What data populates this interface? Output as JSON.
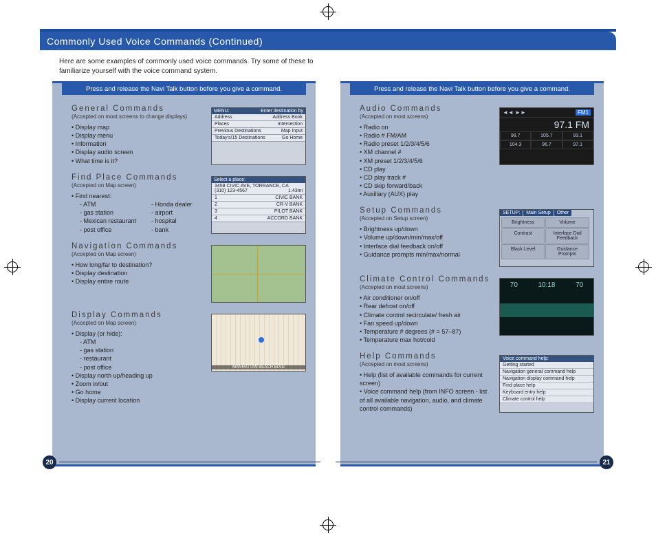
{
  "title": "Commonly Used Voice Commands (Continued)",
  "intro": "Here are some examples of commonly used voice commands. Try some of these to familiarize yourself with the voice command system.",
  "instruction": "Press and release the Navi Talk button before you give a command.",
  "page_left_num": "20",
  "page_right_num": "21",
  "left": {
    "sections": [
      {
        "title": "General Commands",
        "sub": "(Accepted on most screens to change displays)",
        "bullets": [
          "Display map",
          "Display menu",
          "Information",
          "Display audio screen",
          "What time is it?"
        ],
        "thumb": {
          "kind": "menu",
          "hdr_l": "MENU:",
          "hdr_r": "Enter destination by",
          "rows": [
            [
              "Address",
              "Address Book"
            ],
            [
              "Places",
              "Intersection"
            ],
            [
              "Previous Destinations",
              "Map Input"
            ],
            [
              "Today's/15 Destinations",
              "Go Home"
            ]
          ]
        }
      },
      {
        "title": "Find Place Commands",
        "sub": "(Accepted on Map screen)",
        "lead": "Find nearest:",
        "subcols": [
          [
            "ATM",
            "gas station",
            "Mexican restaurant",
            "post office"
          ],
          [
            "Honda dealer",
            "airport",
            "hospital",
            "bank"
          ]
        ],
        "thumb": {
          "kind": "list",
          "hdr": "Select a place:",
          "line1": "3458 CIVIC AVE, TORRANCE, CA",
          "line2": "(310) 123-4567",
          "dist": "1.43mi",
          "rows": [
            "CIVIC BANK",
            "CR-V BANK",
            "PILOT BANK",
            "ACCORD BANK"
          ]
        }
      },
      {
        "title": "Navigation Commands",
        "sub": "(Accepted on Map screen)",
        "bullets": [
          "How long/far to destination?",
          "Display destination",
          "Display entire route"
        ],
        "thumb": {
          "kind": "map"
        }
      },
      {
        "title": "Display Commands",
        "sub": "(Accepted on Map screen)",
        "lead": "Display (or hide):",
        "subcols": [
          [
            "ATM",
            "gas station",
            "restaurant",
            "post office"
          ]
        ],
        "bullets_after": [
          "Display north up/heading up",
          "Zoom in/out",
          "Go home",
          "Display current location"
        ],
        "thumb": {
          "kind": "city",
          "label": "MANHATTAN BEACH BLVD"
        }
      }
    ]
  },
  "right": {
    "sections": [
      {
        "title": "Audio Commands",
        "sub": "(Accepted on most screens)",
        "bullets": [
          "Radio on",
          "Radio # FM/AM",
          "Radio preset 1/2/3/4/5/6",
          "XM channel #",
          "XM preset 1/2/3/4/5/6",
          "CD play",
          "CD play track #",
          "CD skip forward/back",
          "Auxiliary (AUX) play"
        ],
        "thumb": {
          "kind": "radio",
          "band": "FM1",
          "freq": "97.1 FM",
          "presets": [
            "98.7",
            "105.7",
            "93.1",
            "104.3",
            "96.7",
            "97.1"
          ]
        }
      },
      {
        "title": "Setup Commands",
        "sub": "(Accepted on Setup screen)",
        "bullets": [
          "Brightness up/down",
          "Volume up/down/min/max/off",
          "Interface dial feedback on/off",
          "Guidance prompts min/max/normal"
        ],
        "thumb": {
          "kind": "setup",
          "tabs": [
            "SETUP:",
            "Main Setup",
            "Other"
          ],
          "cells": [
            "Brightness",
            "Volume",
            "Contrast",
            "Interface Dial Feedback",
            "Black Level",
            "Guidance Prompts"
          ]
        }
      },
      {
        "title": "Climate Control Commands",
        "sub": "(Accepted on most screens)",
        "bullets": [
          "Air conditioner on/off",
          "Rear defrost on/off",
          "Climate control recirculate/ fresh air",
          "Fan speed up/down",
          "Temperature # degrees (# = 57–87)",
          "Temperature max hot/cold"
        ],
        "thumb": {
          "kind": "climate",
          "readouts": [
            "70",
            "10:18",
            "70"
          ]
        }
      },
      {
        "title": "Help Commands",
        "sub": "(Accepted on most screens)",
        "bullets": [
          "Help (list of available commands for current screen)",
          "Voice command help (from INFO screen - list of all available navigation, audio, and climate control commands)"
        ],
        "thumb": {
          "kind": "help",
          "hdr": "Voice command help:",
          "rows": [
            "Getting started",
            "Navigation general command help",
            "Navigation display command help",
            "Find place help",
            "Keyboard entry help",
            "Climate control help"
          ]
        }
      }
    ]
  }
}
